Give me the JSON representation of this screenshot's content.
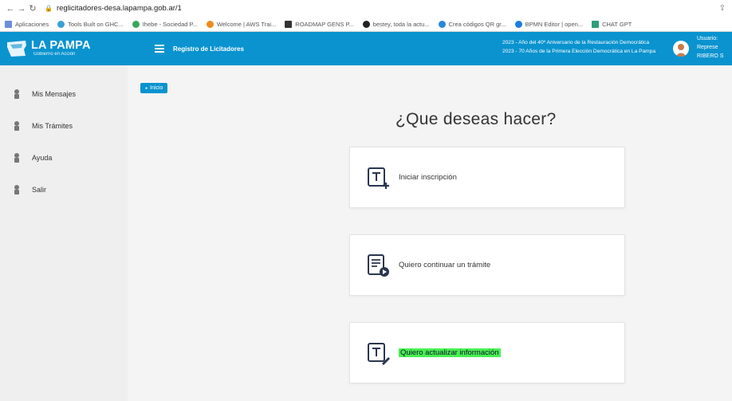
{
  "browser": {
    "url": "reglicitadores-desa.lapampa.gob.ar/1",
    "bookmarks": [
      "Aplicaciones",
      "Tools Built on GHC...",
      "Ihebe - Sociedad P...",
      "Welcome | AWS Trai...",
      "ROADMAP GENS P...",
      "bestey, toda la actu...",
      "Crea códigos QR gr...",
      "BPMN Editor | open...",
      "CHAT GPT"
    ]
  },
  "header": {
    "logo_title": "LA PAMPA",
    "logo_subtitle": "Gobierno en Acción",
    "app_title": "Registro de Licitadores",
    "message_line1": "2023 - Año del 40º Aniversario de la Restauración Democrática",
    "message_line2": "2023 - 70 Años de la Primera Elección Democrática en La Pampa",
    "user_label": "Usuario:",
    "user_role": "Represe",
    "user_name": "RIBERO S"
  },
  "sidebar": {
    "items": [
      {
        "label": "Mis Mensajes"
      },
      {
        "label": "Mis Trámites"
      },
      {
        "label": "Ayuda"
      },
      {
        "label": "Salir"
      }
    ]
  },
  "main": {
    "breadcrumb": "Inicio",
    "title": "¿Que deseas hacer?",
    "cards": [
      {
        "label": "Iniciar inscripción",
        "icon": "file-plus-icon"
      },
      {
        "label": "Quiero continuar un trámite",
        "icon": "file-continue-icon"
      },
      {
        "label": "Quiero actualizar información",
        "icon": "file-edit-icon"
      }
    ]
  },
  "colors": {
    "brand": "#0a93cf",
    "highlight": "#48f050"
  }
}
